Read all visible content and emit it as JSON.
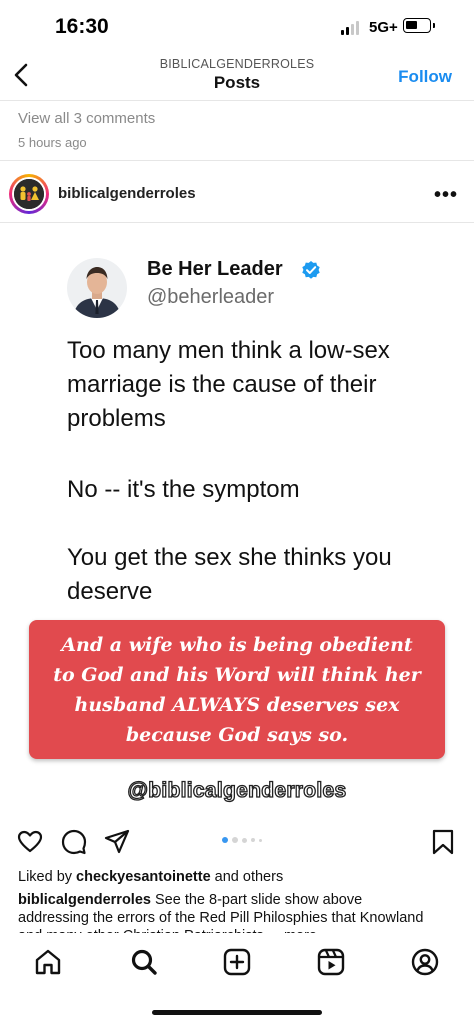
{
  "status_bar": {
    "time": "16:30",
    "network": "5G+"
  },
  "header": {
    "account": "BIBLICALGENDERROLES",
    "title": "Posts",
    "follow_label": "Follow"
  },
  "previous_post": {
    "view_comments": "View all 3 comments",
    "time_ago": "5 hours ago"
  },
  "post": {
    "username": "biblicalgenderroles",
    "more_icon": "more-dots-icon",
    "tweet": {
      "name": "Be Her Leader",
      "handle": "@beherleader",
      "paragraphs": [
        "Too many men think a low-sex marriage is the cause of their problems",
        "No -- it's the symptom",
        "You get the sex she thinks you deserve"
      ]
    },
    "overlay_text": "And a wife who is being obedient to God and his Word will think her husband ALWAYS deserves sex because God says so.",
    "watermark": "@biblicalgenderroles",
    "carousel": {
      "total": 5,
      "active": 1
    },
    "liked_by_prefix": "Liked by ",
    "liked_by_user": "checkyesantoinette",
    "liked_by_suffix": " and others",
    "caption_user": "biblicalgenderroles",
    "caption_text": " See the 8-part slide show above addressing the errors of the Red Pill Philosphies that Knowland and many other Christian Patriarchists ... more"
  },
  "colors": {
    "accent": "#1a8cf0",
    "overlay_box": "#e14a4e",
    "verified": "#1d9bf0"
  },
  "tab_bar": {
    "items": [
      "home-icon",
      "search-icon",
      "create-icon",
      "reels-icon",
      "profile-icon"
    ]
  }
}
